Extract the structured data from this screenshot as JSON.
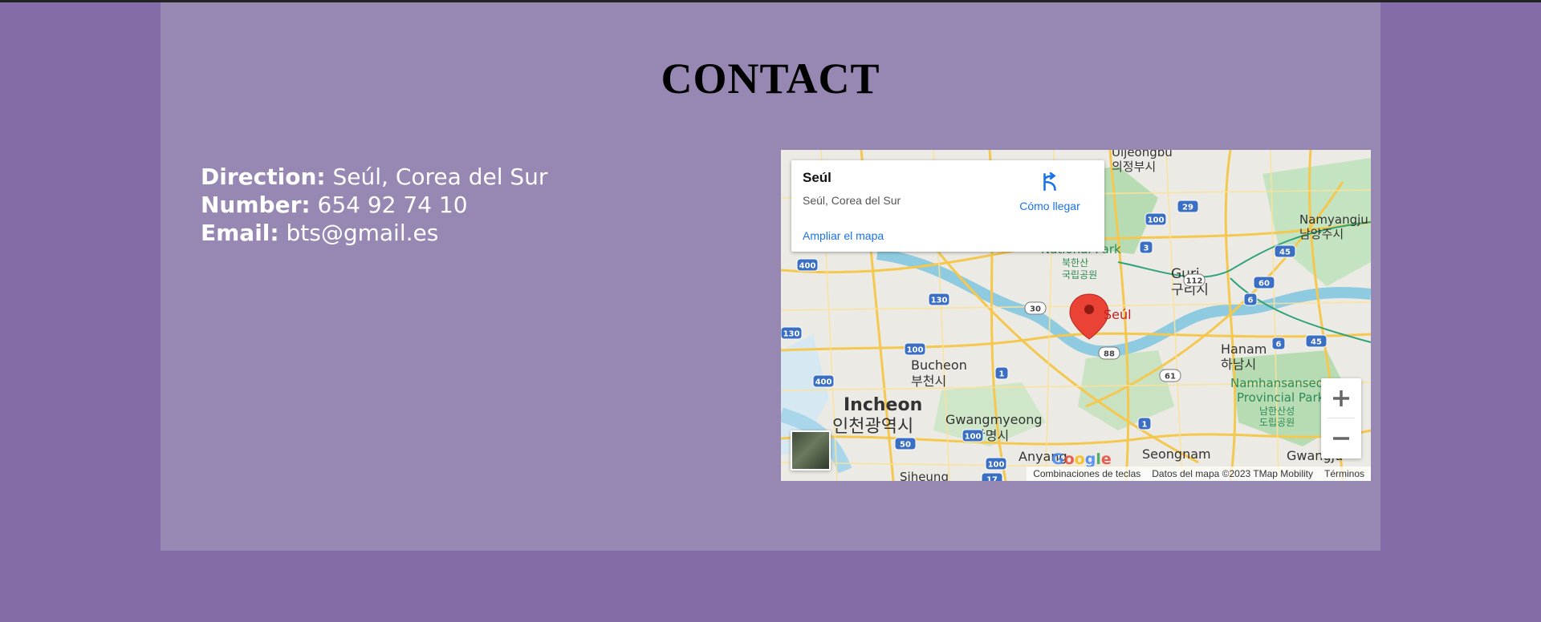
{
  "page": {
    "title": "CONTACT"
  },
  "contact": {
    "direction_label": "Direction:",
    "direction_value": "Seúl, Corea del Sur",
    "number_label": "Number:",
    "number_value": "654 92 74 10",
    "email_label": "Email:",
    "email_value": "bts@gmail.es"
  },
  "map": {
    "card": {
      "place": "Seúl",
      "address": "Seúl, Corea del Sur",
      "directions": "Cómo llegar",
      "enlarge": "Ampliar el mapa"
    },
    "pin_label": "Seúl",
    "labels": {
      "uijeongbu": "Uijeongbu",
      "uijeongbu_kr": "의정부시",
      "namyangju": "Namyangju",
      "namyangju_kr": "남양주시",
      "guri": "Guri",
      "guri_kr": "구리시",
      "hanam": "Hanam",
      "hanam_kr": "하남시",
      "bucheon": "Bucheon",
      "bucheon_kr": "부천시",
      "incheon": "Incheon",
      "incheon_kr": "인천광역시",
      "gwangmyeong": "Gwangmyeong",
      "gwangmyeong_kr": "광명시",
      "anyang": "Anyang",
      "seongnam": "Seongnam",
      "gwangju": "Gwangju",
      "siheung": "Siheung",
      "park": "Namhansanseong",
      "park2": "Provincial Park",
      "park_kr": "남한산성",
      "park_kr2": "도립공원",
      "natpark": "National Park",
      "natpark_kr": "북한산",
      "natpark_kr2": "국립공원"
    },
    "shields": [
      "400",
      "130",
      "30",
      "130",
      "100",
      "400",
      "1",
      "100",
      "50",
      "100",
      "17",
      "1",
      "88",
      "61",
      "112",
      "60",
      "6",
      "45",
      "6",
      "45",
      "3",
      "100",
      "29"
    ],
    "logo": "Google",
    "attribution": {
      "shortcuts": "Combinaciones de teclas",
      "data": "Datos del mapa ©2023 TMap Mobility",
      "terms": "Términos"
    },
    "colors": {
      "road_major": "#f9d56c",
      "water": "#8fcbe0",
      "green": "#a8d8a8",
      "urban": "#e9e6e0",
      "pin": "#ea4335"
    }
  }
}
